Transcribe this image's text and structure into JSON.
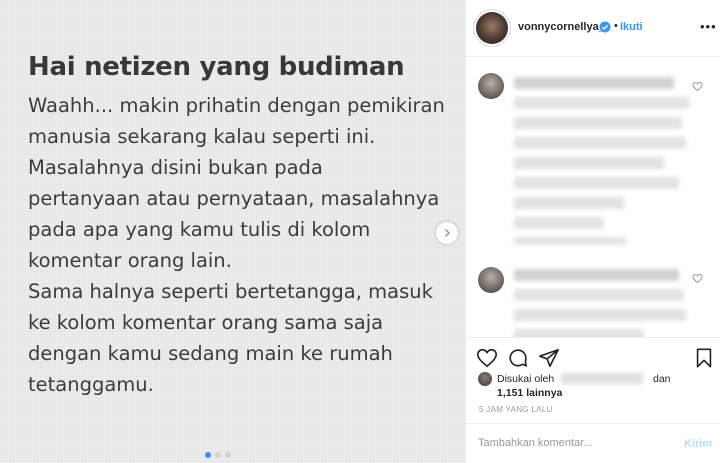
{
  "post_image": {
    "heading": "Hai netizen yang budiman",
    "body_lines": [
      "Waahh... makin prihatin dengan pemikiran",
      "manusia sekarang kalau seperti ini.",
      "Masalahnya disini bukan pada",
      "pertanyaan atau pernyataan, masalahnya",
      "pada apa yang kamu tulis di kolom",
      "komentar orang lain.",
      "Sama halnya seperti bertetangga, masuk",
      "ke kolom komentar orang sama saja",
      "dengan kamu sedang main ke rumah",
      "tetanggamu."
    ],
    "next_icon": "chevron-right-icon"
  },
  "header": {
    "username": "vonnycornellya_",
    "separator": "•",
    "follow_label": "Ikuti",
    "verified_icon": "verified-badge-icon",
    "more_icon": "more-options-icon"
  },
  "likes": {
    "liked_by": "Disukai oleh",
    "and_word": "dan",
    "count": "1,151 lainnya"
  },
  "timestamp": "5 JAM YANG LALU",
  "comment_box": {
    "placeholder": "Tambahkan komentar...",
    "post_label": "Kirim"
  },
  "colors": {
    "accent": "#3897f0",
    "post_disabled": "#b2dffc",
    "image_background": "#ececec",
    "image_text": "#3c3c3c"
  }
}
